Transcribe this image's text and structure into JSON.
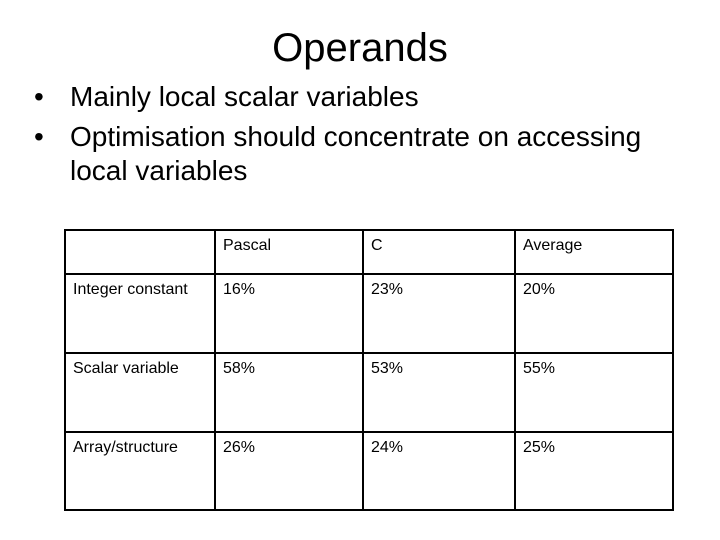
{
  "slide": {
    "title": "Operands",
    "bullets": [
      "Mainly local scalar variables",
      "Optimisation should concentrate on accessing local variables"
    ],
    "bullet_glyph": "•"
  },
  "table": {
    "headers": [
      "",
      "Pascal",
      "C",
      "Average"
    ],
    "rows": [
      [
        "Integer constant",
        "16%",
        "23%",
        "20%"
      ],
      [
        "Scalar variable",
        "58%",
        "53%",
        "55%"
      ],
      [
        "Array/structure",
        "26%",
        "24%",
        "25%"
      ]
    ]
  }
}
